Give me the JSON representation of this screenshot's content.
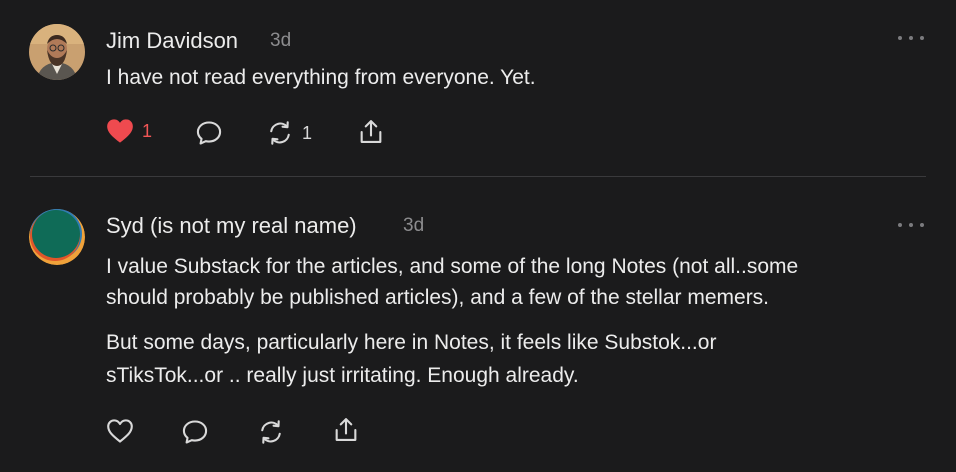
{
  "colors": {
    "background": "#1b1b1c",
    "like_active": "#ef4a4f",
    "text": "#ececec",
    "muted": "#8c8c8e"
  },
  "notes": [
    {
      "author": "Jim Davidson",
      "time": "3d",
      "avatar": "photo-avatar",
      "body": [
        "I have not read everything from everyone. Yet."
      ],
      "actions": {
        "likes": "1",
        "liked": true,
        "restacks": "1"
      }
    },
    {
      "author": "Syd (is not my real name)",
      "time": "3d",
      "avatar": "gradient-avatar",
      "body": [
        "I value Substack for the articles, and some of the long Notes (not all..some",
        "should probably be published articles), and a few of the stellar memers.",
        "But some days, particularly here in Notes, it feels like Substok...or",
        "sTiksTok...or .. really just irritating. Enough already."
      ],
      "actions": {
        "likes": "",
        "liked": false,
        "restacks": ""
      }
    }
  ]
}
